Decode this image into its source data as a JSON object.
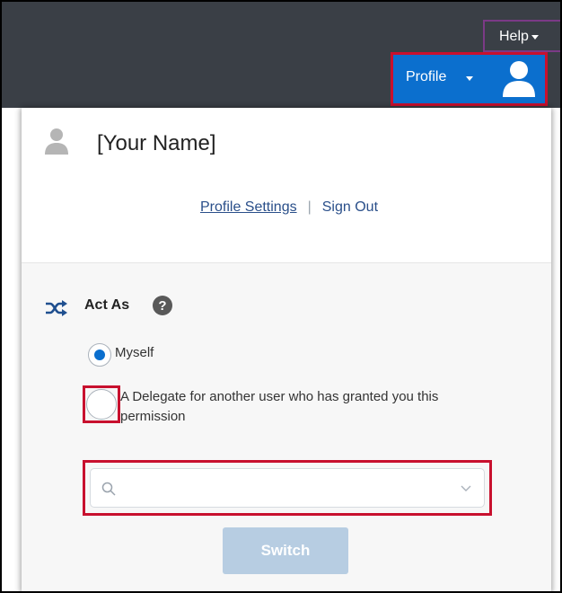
{
  "header": {
    "help_label": "Help",
    "profile_label": "Profile"
  },
  "panel": {
    "user_name": "[Your Name]",
    "links": {
      "profile_settings": "Profile Settings",
      "separator": "|",
      "sign_out": "Sign Out"
    },
    "act_as": {
      "label": "Act As",
      "help_glyph": "?",
      "options": [
        {
          "label": "Myself",
          "selected": true
        },
        {
          "label": "A Delegate for another user who has granted you this permission",
          "selected": false
        }
      ],
      "search_value": "",
      "switch_label": "Switch"
    }
  },
  "icons": {
    "help_caret": "chevron-down-icon",
    "profile_caret": "chevron-down-icon",
    "profile_avatar": "user-avatar-icon",
    "panel_user": "user-silhouette-icon",
    "act_as": "shuffle-icon",
    "act_as_help": "question-circle-icon",
    "search": "search-icon",
    "dropdown": "chevron-down-icon"
  },
  "colors": {
    "topbar": "#3a3f46",
    "profile_button": "#0b6fce",
    "highlight_red": "#c8102e",
    "highlight_purple": "#7b3a86",
    "radio_selected": "#0b6fce",
    "switch_disabled": "#b7cde2",
    "link": "#2a4f8a",
    "panel_lower_bg": "#f7f7f7"
  }
}
